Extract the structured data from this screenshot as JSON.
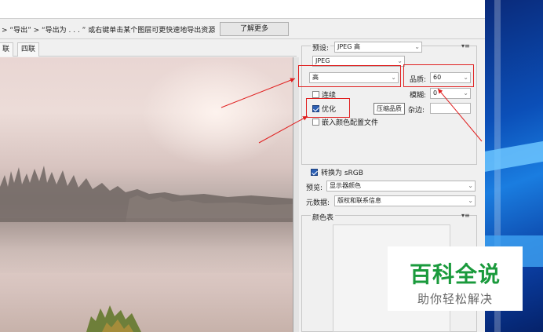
{
  "info": {
    "text": "> “导出” > “导出为 . . . ” 或右键单击某个图层可更快速地导出资源",
    "learn_more": "了解更多"
  },
  "tabs": [
    "联",
    "四联"
  ],
  "panel": {
    "preset_label": "预设:",
    "preset_value": "JPEG 高",
    "format_value": "JPEG",
    "quality_level": "高",
    "quality_label": "品质:",
    "quality_value": "60",
    "progressive": "连续",
    "blur_label": "模糊:",
    "blur_value": "0",
    "optimized": "优化",
    "optimized_checked": true,
    "matte_label": "杂边:",
    "embed_profile": "嵌入颜色配置文件",
    "convert_srgb": "转换为 sRGB",
    "convert_srgb_checked": true,
    "preview_label": "预览:",
    "preview_value": "显示器颜色",
    "metadata_label": "元数据:",
    "metadata_value": "版权和联系信息",
    "color_table_label": "颜色表",
    "tooltip": "压缩品质",
    "panel_menu_icon": "menu-icon"
  },
  "watermark": {
    "title": "百科全说",
    "subtitle": "助你轻松解决"
  },
  "colors": {
    "annotation": "#e02020",
    "watermark_green": "#1a9a3c",
    "checkbox_blue": "#2b5fb4"
  }
}
